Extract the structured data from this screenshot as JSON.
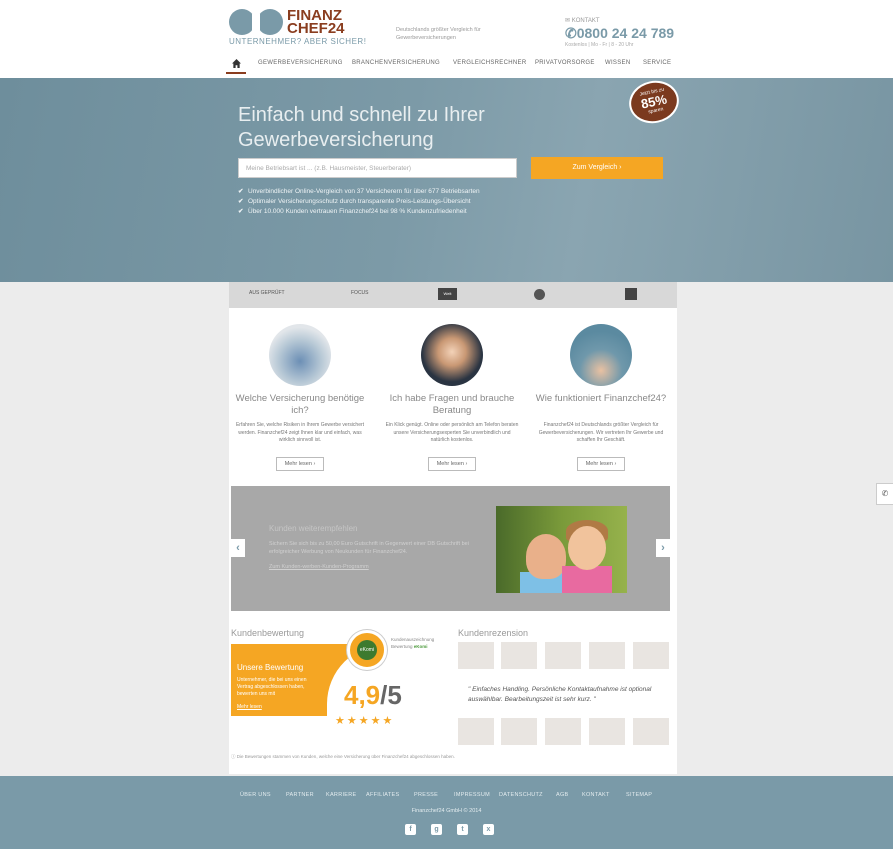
{
  "header": {
    "brand_line1": "FINANZ",
    "brand_line2": "CHEF24",
    "tagline": "UNTERNEHMER? ABER SICHER!",
    "claim": "Deutschlands größter Vergleich für Gewerbeversicherungen",
    "contact_label": "KONTAKT",
    "phone": "0800 24 24 789",
    "hours": "Kostenlos | Mo - Fr | 8 - 20 Uhr"
  },
  "nav": {
    "items": [
      "GEWERBEVERSICHERUNG",
      "BRANCHENVERSICHERUNG",
      "VERGLEICHSRECHNER",
      "PRIVATVORSORGE",
      "WISSEN",
      "SERVICE"
    ]
  },
  "hero": {
    "title": "Einfach und schnell zu Ihrer Gewerbeversicherung",
    "badge_top": "Jetzt bis zu",
    "badge_value": "85%",
    "badge_bottom": "sparen",
    "search_placeholder": "Meine Betriebsart ist ... (z.B. Hausmeister, Steuerberater)",
    "search_button": "Zum Vergleich",
    "checks": [
      "Unverbindlicher Online-Vergleich von 37 Versicherern für über 677 Betriebsarten",
      "Optimaler Versicherungsschutz durch transparente Preis-Leistungs-Übersicht",
      "Über 10.000 Kunden vertrauen Finanzchef24 bei 98 % Kundenzufriedenheit"
    ]
  },
  "strip": {
    "logo1": "AUS GEPRÜFT",
    "logo2": "FOCUS",
    "logo3": "Welt"
  },
  "features": [
    {
      "title": "Welche Versicherung benötige ich?",
      "text": "Erfahren Sie, welche Risiken in Ihrem Gewerbe versichert werden. Finanzchef24 zeigt Ihnen klar und einfach, was wirklich sinnvoll ist.",
      "button": "Mehr lesen"
    },
    {
      "title": "Ich habe Fragen und brauche Beratung",
      "text": "Ein Klick genügt. Online oder persönlich am Telefon beraten unsere Versicherungsexperten Sie unverbindlich und natürlich kostenlos.",
      "button": "Mehr lesen"
    },
    {
      "title": "Wie funktioniert Finanzchef24?",
      "text": "Finanzchef24 ist Deutschlands größter Vergleich für Gewerbeversicherungen. Wir vertreten Ihr Gewerbe und schaffen Ihr Geschäft.",
      "button": "Mehr lesen"
    }
  ],
  "slider": {
    "title": "Kunden weiterempfehlen",
    "text": "Sichern Sie sich bis zu 50,00 Euro Gutschrift in Gegenwert einer DB Gutschrift bei erfolgreicher Werbung von Neukunden für Finanzchef24.",
    "link": "Zum Kunden-werben-Kunden-Programm"
  },
  "reviews": {
    "section_title": "Kundenbewertung",
    "box_title": "Unsere Bewertung",
    "box_text": "Unternehmer, die bei uns einen Vertrag abgeschlossen haben, bewerten uns mit",
    "box_link": "Mehr lesen",
    "seal_label": "eKomi",
    "seal_text_1": "Kundenauszeichnung",
    "seal_text_2": "Bewertung",
    "seal_text_3": "eKomi",
    "rating": "4,9",
    "rating_of": "/5",
    "stars": "★★★★★",
    "footnote": "Die Bewertungen stammen von Kunden, welche eine Versicherung über Finanzchef24 abgeschlossen haben."
  },
  "testimonials": {
    "section_title": "Kundenrezension",
    "quote": "\" Einfaches Handling. Persönliche Kontaktaufnahme ist optional auswählbar. Bearbeitungszeit ist sehr kurz. \""
  },
  "footer": {
    "links": [
      "ÜBER UNS",
      "PARTNER",
      "KARRIERE",
      "AFFILIATES",
      "PRESSE",
      "IMPRESSUM",
      "DATENSCHUTZ",
      "AGB",
      "KONTAKT",
      "SITEMAP"
    ],
    "copyright": "Finanzchef24 GmbH © 2014",
    "social": [
      "f",
      "g",
      "t",
      "x"
    ]
  },
  "colors": {
    "accent": "#f5a623",
    "brand": "#8a3d1f",
    "teal": "#7a9aa8"
  }
}
